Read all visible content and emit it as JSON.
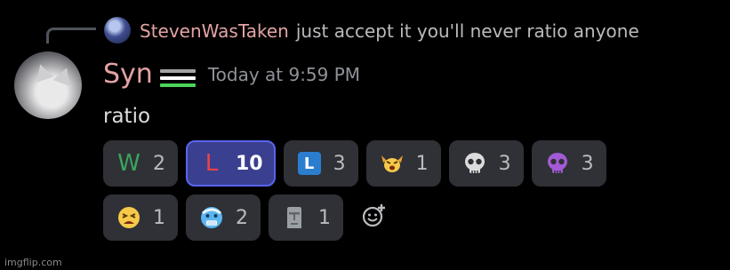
{
  "reply": {
    "author": "StevenWasTaken",
    "text": "just accept it you'll never ratio anyone"
  },
  "message": {
    "username": "Syn",
    "timestamp": "Today at 9:59 PM",
    "content": "ratio",
    "flag_colors": [
      "#000000",
      "#a3a3a3",
      "#ffffff",
      "#4cd45a"
    ]
  },
  "reactions": [
    {
      "label": "W",
      "icon": "w-letter-icon",
      "count": "2",
      "active": false
    },
    {
      "label": "L",
      "icon": "l-letter-icon",
      "count": "10",
      "active": true
    },
    {
      "label": "L",
      "icon": "l-square-icon",
      "count": "3",
      "active": false
    },
    {
      "icon": "angry-horns-icon",
      "count": "1",
      "active": false
    },
    {
      "icon": "skull-icon",
      "count": "3",
      "active": false
    },
    {
      "icon": "purple-skull-icon",
      "count": "3",
      "active": false
    },
    {
      "icon": "tired-face-icon",
      "count": "1",
      "active": false
    },
    {
      "icon": "cold-face-icon",
      "count": "2",
      "active": false
    },
    {
      "icon": "moai-icon",
      "count": "1",
      "active": false
    }
  ],
  "watermark": "imgflip.com"
}
